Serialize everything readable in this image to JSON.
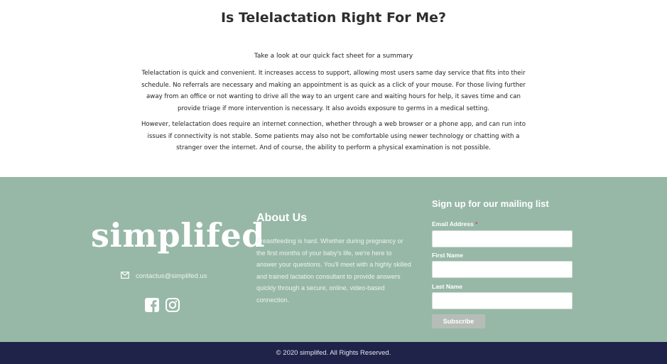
{
  "section": {
    "title": "Is Telelactation Right For Me?",
    "intro": "Take a look at our quick fact sheet for a summary",
    "paragraph_1": "Telelactation is quick and convenient. It increases access to support, allowing most users same day service that fits into their schedule. No referrals are necessary and making an appointment is as quick as a click of your mouse. For those living further away from an office or not wanting to drive all the way to an urgent care and waiting hours for help, it saves time and can provide triage if more intervention is necessary. It also avoids exposure to germs in a medical setting.",
    "paragraph_2": "However, telelactation does require an internet connection, whether through a web browser or a phone app, and can run into issues if connectivity is not stable. Some patients may also not be comfortable using newer technology or chatting with a stranger over the internet. And of course, the ability to perform a physical examination is not possible."
  },
  "footer": {
    "logo_text": "simplifed",
    "contact_email": "contactus@simplifed.us",
    "social": {
      "facebook_icon": "facebook-icon",
      "instagram_icon": "instagram-icon"
    },
    "about": {
      "title": "About Us",
      "text": "Breastfeeding is hard. Whether during pregnancy or the first months of your baby's life, we're here to answer your questions. You'll meet with a highly skilled and trained lactation consultant to provide answers quickly through a secure, online, video-based connection."
    },
    "mailing": {
      "title": "Sign up for our mailing list",
      "email_label": "Email Address",
      "required_mark": "*",
      "email_value": "",
      "first_name_label": "First Name",
      "first_name_value": "",
      "last_name_label": "Last Name",
      "last_name_value": "",
      "subscribe_label": "Subscribe"
    }
  },
  "copyright": "© 2020 simplifed. All Rights Reserved.",
  "colors": {
    "footer_bg": "#97b8a7",
    "bottom_bar_bg": "#1f2249",
    "subscribe_bg": "#b6bdb8",
    "required_mark": "#d94a4a"
  }
}
